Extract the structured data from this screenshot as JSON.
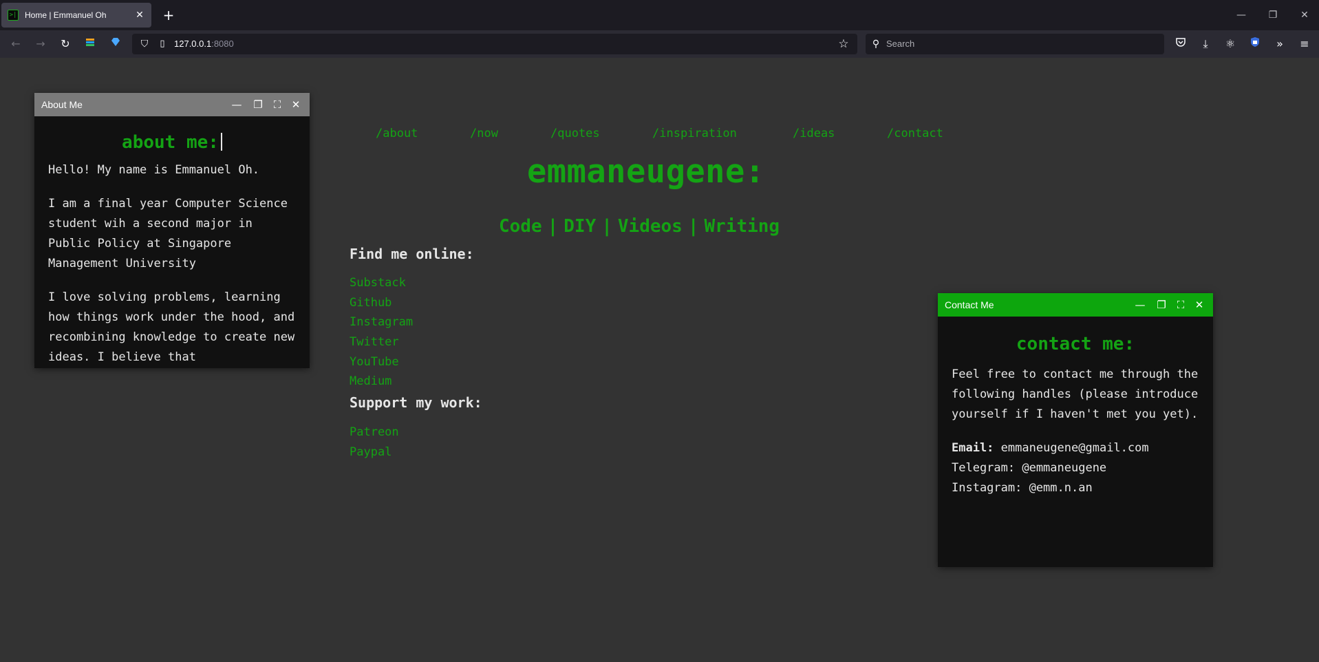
{
  "browser": {
    "tab_title": "Home | Emmanuel Oh",
    "tab_favicon": ">|",
    "url_host": "127.0.0.1",
    "url_port": ":8080",
    "search_placeholder": "Search"
  },
  "nav": {
    "items": [
      "/about",
      "/now",
      "/quotes",
      "/inspiration",
      "/ideas",
      "/contact"
    ]
  },
  "site": {
    "title": "emmaneugene:",
    "categories": [
      "Code",
      "DIY",
      "Videos",
      "Writing"
    ],
    "separator": "|",
    "find_heading": "Find me online:",
    "find_links": [
      "Substack",
      "Github",
      "Instagram",
      "Twitter",
      "YouTube",
      "Medium"
    ],
    "support_heading": "Support my work:",
    "support_links": [
      "Patreon",
      "Paypal"
    ]
  },
  "about_window": {
    "title": "About Me",
    "heading": "about me:",
    "paragraphs": [
      "Hello! My name is Emmanuel Oh.",
      "I am a final year Computer Science student wih a second major in Public Policy at Singapore Management University",
      "I love solving problems, learning how things work under the hood, and recombining knowledge to create new ideas. I believe that"
    ]
  },
  "contact_window": {
    "title": "Contact Me",
    "heading": "contact me:",
    "intro": "Feel free to contact me through the following handles (please introduce yourself if I haven't met you yet).",
    "email_label": "Email:",
    "email_value": "emmaneugene@gmail.com",
    "telegram": "Telegram: @emmaneugene",
    "instagram": "Instagram: @emm.n.an"
  },
  "colors": {
    "accent_green": "#14a314",
    "background": "#333333",
    "window_body": "#111111"
  }
}
